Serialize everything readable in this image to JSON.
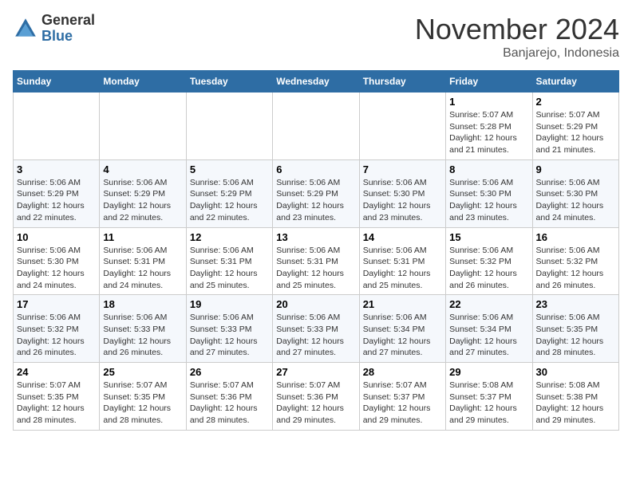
{
  "logo": {
    "general": "General",
    "blue": "Blue"
  },
  "header": {
    "month": "November 2024",
    "location": "Banjarejo, Indonesia"
  },
  "weekdays": [
    "Sunday",
    "Monday",
    "Tuesday",
    "Wednesday",
    "Thursday",
    "Friday",
    "Saturday"
  ],
  "weeks": [
    [
      {
        "day": "",
        "sunrise": "",
        "sunset": "",
        "daylight": ""
      },
      {
        "day": "",
        "sunrise": "",
        "sunset": "",
        "daylight": ""
      },
      {
        "day": "",
        "sunrise": "",
        "sunset": "",
        "daylight": ""
      },
      {
        "day": "",
        "sunrise": "",
        "sunset": "",
        "daylight": ""
      },
      {
        "day": "",
        "sunrise": "",
        "sunset": "",
        "daylight": ""
      },
      {
        "day": "1",
        "sunrise": "Sunrise: 5:07 AM",
        "sunset": "Sunset: 5:28 PM",
        "daylight": "Daylight: 12 hours and 21 minutes."
      },
      {
        "day": "2",
        "sunrise": "Sunrise: 5:07 AM",
        "sunset": "Sunset: 5:29 PM",
        "daylight": "Daylight: 12 hours and 21 minutes."
      }
    ],
    [
      {
        "day": "3",
        "sunrise": "Sunrise: 5:06 AM",
        "sunset": "Sunset: 5:29 PM",
        "daylight": "Daylight: 12 hours and 22 minutes."
      },
      {
        "day": "4",
        "sunrise": "Sunrise: 5:06 AM",
        "sunset": "Sunset: 5:29 PM",
        "daylight": "Daylight: 12 hours and 22 minutes."
      },
      {
        "day": "5",
        "sunrise": "Sunrise: 5:06 AM",
        "sunset": "Sunset: 5:29 PM",
        "daylight": "Daylight: 12 hours and 22 minutes."
      },
      {
        "day": "6",
        "sunrise": "Sunrise: 5:06 AM",
        "sunset": "Sunset: 5:29 PM",
        "daylight": "Daylight: 12 hours and 23 minutes."
      },
      {
        "day": "7",
        "sunrise": "Sunrise: 5:06 AM",
        "sunset": "Sunset: 5:30 PM",
        "daylight": "Daylight: 12 hours and 23 minutes."
      },
      {
        "day": "8",
        "sunrise": "Sunrise: 5:06 AM",
        "sunset": "Sunset: 5:30 PM",
        "daylight": "Daylight: 12 hours and 23 minutes."
      },
      {
        "day": "9",
        "sunrise": "Sunrise: 5:06 AM",
        "sunset": "Sunset: 5:30 PM",
        "daylight": "Daylight: 12 hours and 24 minutes."
      }
    ],
    [
      {
        "day": "10",
        "sunrise": "Sunrise: 5:06 AM",
        "sunset": "Sunset: 5:30 PM",
        "daylight": "Daylight: 12 hours and 24 minutes."
      },
      {
        "day": "11",
        "sunrise": "Sunrise: 5:06 AM",
        "sunset": "Sunset: 5:31 PM",
        "daylight": "Daylight: 12 hours and 24 minutes."
      },
      {
        "day": "12",
        "sunrise": "Sunrise: 5:06 AM",
        "sunset": "Sunset: 5:31 PM",
        "daylight": "Daylight: 12 hours and 25 minutes."
      },
      {
        "day": "13",
        "sunrise": "Sunrise: 5:06 AM",
        "sunset": "Sunset: 5:31 PM",
        "daylight": "Daylight: 12 hours and 25 minutes."
      },
      {
        "day": "14",
        "sunrise": "Sunrise: 5:06 AM",
        "sunset": "Sunset: 5:31 PM",
        "daylight": "Daylight: 12 hours and 25 minutes."
      },
      {
        "day": "15",
        "sunrise": "Sunrise: 5:06 AM",
        "sunset": "Sunset: 5:32 PM",
        "daylight": "Daylight: 12 hours and 26 minutes."
      },
      {
        "day": "16",
        "sunrise": "Sunrise: 5:06 AM",
        "sunset": "Sunset: 5:32 PM",
        "daylight": "Daylight: 12 hours and 26 minutes."
      }
    ],
    [
      {
        "day": "17",
        "sunrise": "Sunrise: 5:06 AM",
        "sunset": "Sunset: 5:32 PM",
        "daylight": "Daylight: 12 hours and 26 minutes."
      },
      {
        "day": "18",
        "sunrise": "Sunrise: 5:06 AM",
        "sunset": "Sunset: 5:33 PM",
        "daylight": "Daylight: 12 hours and 26 minutes."
      },
      {
        "day": "19",
        "sunrise": "Sunrise: 5:06 AM",
        "sunset": "Sunset: 5:33 PM",
        "daylight": "Daylight: 12 hours and 27 minutes."
      },
      {
        "day": "20",
        "sunrise": "Sunrise: 5:06 AM",
        "sunset": "Sunset: 5:33 PM",
        "daylight": "Daylight: 12 hours and 27 minutes."
      },
      {
        "day": "21",
        "sunrise": "Sunrise: 5:06 AM",
        "sunset": "Sunset: 5:34 PM",
        "daylight": "Daylight: 12 hours and 27 minutes."
      },
      {
        "day": "22",
        "sunrise": "Sunrise: 5:06 AM",
        "sunset": "Sunset: 5:34 PM",
        "daylight": "Daylight: 12 hours and 27 minutes."
      },
      {
        "day": "23",
        "sunrise": "Sunrise: 5:06 AM",
        "sunset": "Sunset: 5:35 PM",
        "daylight": "Daylight: 12 hours and 28 minutes."
      }
    ],
    [
      {
        "day": "24",
        "sunrise": "Sunrise: 5:07 AM",
        "sunset": "Sunset: 5:35 PM",
        "daylight": "Daylight: 12 hours and 28 minutes."
      },
      {
        "day": "25",
        "sunrise": "Sunrise: 5:07 AM",
        "sunset": "Sunset: 5:35 PM",
        "daylight": "Daylight: 12 hours and 28 minutes."
      },
      {
        "day": "26",
        "sunrise": "Sunrise: 5:07 AM",
        "sunset": "Sunset: 5:36 PM",
        "daylight": "Daylight: 12 hours and 28 minutes."
      },
      {
        "day": "27",
        "sunrise": "Sunrise: 5:07 AM",
        "sunset": "Sunset: 5:36 PM",
        "daylight": "Daylight: 12 hours and 29 minutes."
      },
      {
        "day": "28",
        "sunrise": "Sunrise: 5:07 AM",
        "sunset": "Sunset: 5:37 PM",
        "daylight": "Daylight: 12 hours and 29 minutes."
      },
      {
        "day": "29",
        "sunrise": "Sunrise: 5:08 AM",
        "sunset": "Sunset: 5:37 PM",
        "daylight": "Daylight: 12 hours and 29 minutes."
      },
      {
        "day": "30",
        "sunrise": "Sunrise: 5:08 AM",
        "sunset": "Sunset: 5:38 PM",
        "daylight": "Daylight: 12 hours and 29 minutes."
      }
    ]
  ]
}
